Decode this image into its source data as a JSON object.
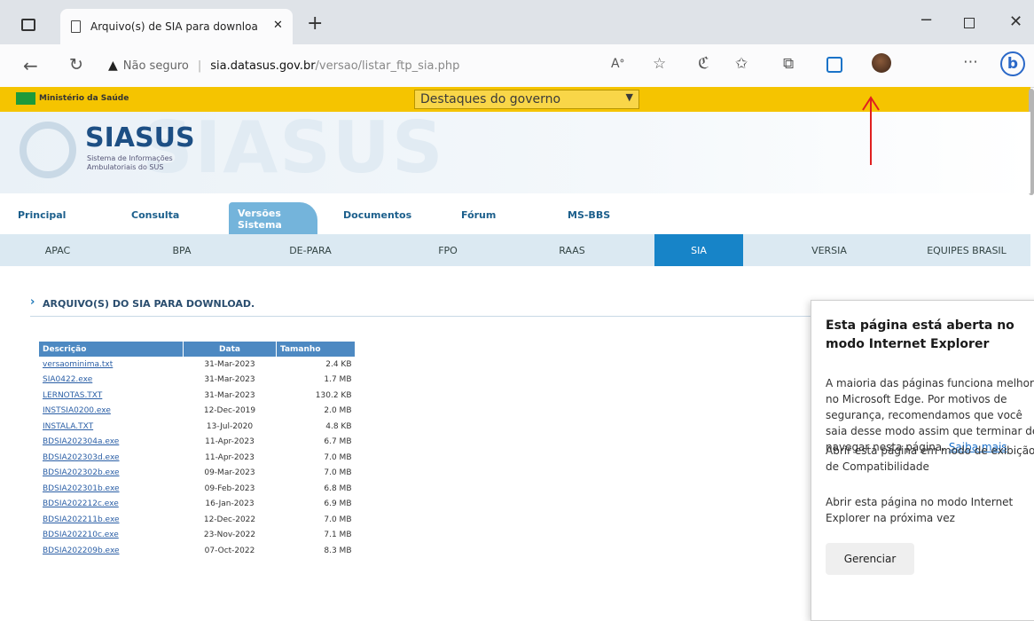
{
  "browser": {
    "tab_title": "Arquivo(s) de SIA para downloa",
    "new_tab": "+",
    "not_secure": "Não seguro",
    "url_domain": "sia.datasus.gov.br",
    "url_path": "/versao/listar_ftp_sia.php"
  },
  "govbar": {
    "ministry": "Ministério da Saúde",
    "select_value": "Destaques do governo"
  },
  "brand": {
    "name": "SIASUS",
    "sub1": "Sistema de Informações",
    "sub2": "Ambulatoriais do SUS"
  },
  "nav": {
    "tabs": [
      "Principal",
      "Consulta",
      "Versões Sistema",
      "Documentos",
      "Fórum",
      "MS-BBS"
    ],
    "sub": [
      "APAC",
      "BPA",
      "DE-PARA",
      "FPO",
      "RAAS",
      "SIA",
      "VERSIA",
      "EQUIPES BRASIL"
    ]
  },
  "main": {
    "heading": "ARQUIVO(S) DO SIA PARA DOWNLOAD.",
    "columns": [
      "Descrição",
      "Data",
      "Tamanho"
    ],
    "rows": [
      {
        "desc": "versaominima.txt",
        "data": "31-Mar-2023",
        "size": "2.4 KB"
      },
      {
        "desc": "SIA0422.exe",
        "data": "31-Mar-2023",
        "size": "1.7 MB"
      },
      {
        "desc": "LERNOTAS.TXT",
        "data": "31-Mar-2023",
        "size": "130.2 KB"
      },
      {
        "desc": "INSTSIA0200.exe",
        "data": "12-Dec-2019",
        "size": "2.0 MB"
      },
      {
        "desc": "INSTALA.TXT",
        "data": "13-Jul-2020",
        "size": "4.8 KB"
      },
      {
        "desc": "BDSIA202304a.exe",
        "data": "11-Apr-2023",
        "size": "6.7 MB"
      },
      {
        "desc": "BDSIA202303d.exe",
        "data": "11-Apr-2023",
        "size": "7.0 MB"
      },
      {
        "desc": "BDSIA202302b.exe",
        "data": "09-Mar-2023",
        "size": "7.0 MB"
      },
      {
        "desc": "BDSIA202301b.exe",
        "data": "09-Feb-2023",
        "size": "6.8 MB"
      },
      {
        "desc": "BDSIA202212c.exe",
        "data": "16-Jan-2023",
        "size": "6.9 MB"
      },
      {
        "desc": "BDSIA202211b.exe",
        "data": "12-Dec-2022",
        "size": "7.0 MB"
      },
      {
        "desc": "BDSIA202210c.exe",
        "data": "23-Nov-2022",
        "size": "7.1 MB"
      },
      {
        "desc": "BDSIA202209b.exe",
        "data": "07-Oct-2022",
        "size": "8.3 MB"
      }
    ]
  },
  "popup": {
    "title": "Esta página está aberta no modo Internet Explorer",
    "body": "A maioria das páginas funciona melhor no Microsoft Edge. Por motivos de segurança, recomendamos que você saia desse modo assim que terminar de navegar nesta página.",
    "learn_more": "Saiba mais",
    "opt1": "Abrir esta página em modo de exibição de Compatibilidade",
    "opt2": "Abrir esta página no modo Internet Explorer na próxima vez",
    "manage": "Gerenciar"
  },
  "colors": {
    "gov_yellow": "#f5c400",
    "arrow_red": "#e02020",
    "active_tab": "#1784c8"
  }
}
